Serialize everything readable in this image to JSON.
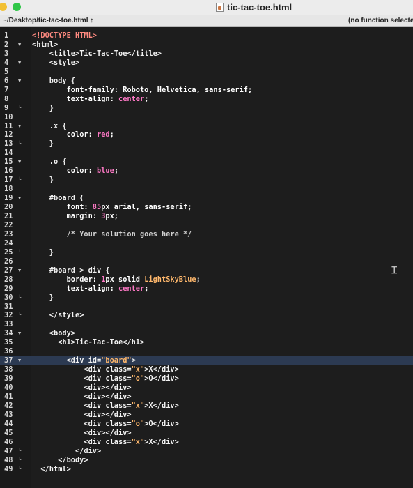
{
  "window": {
    "title": "tic-tac-toe.html"
  },
  "navbar": {
    "path": "~/Desktop/tic-tac-toe.html ↕",
    "function_popup": "(no function selecte"
  },
  "editor": {
    "active_line": 37,
    "lines": [
      {
        "n": "1",
        "fold": "",
        "indent": 0,
        "tokens": [
          [
            "<!DOCTYPE HTML>",
            "doctype"
          ]
        ]
      },
      {
        "n": "2",
        "fold": "down",
        "indent": 0,
        "tokens": [
          [
            "<html>",
            "tag"
          ]
        ]
      },
      {
        "n": "3",
        "fold": "",
        "indent": 2,
        "tokens": [
          [
            "<title>",
            "tag"
          ],
          [
            "Tic-Tac-Toe",
            "txt"
          ],
          [
            "</title>",
            "tag"
          ]
        ]
      },
      {
        "n": "4",
        "fold": "down",
        "indent": 2,
        "tokens": [
          [
            "<style>",
            "tag"
          ]
        ]
      },
      {
        "n": "5",
        "fold": "",
        "indent": 0,
        "tokens": []
      },
      {
        "n": "6",
        "fold": "down",
        "indent": 2,
        "tokens": [
          [
            "body {",
            "sel"
          ]
        ]
      },
      {
        "n": "7",
        "fold": "",
        "indent": 4,
        "tokens": [
          [
            "font-family: ",
            "prop"
          ],
          [
            "Roboto, Helvetica, sans-serif;",
            "prop"
          ]
        ]
      },
      {
        "n": "8",
        "fold": "",
        "indent": 4,
        "tokens": [
          [
            "text-align: ",
            "prop"
          ],
          [
            "center",
            "val"
          ],
          [
            ";",
            "prop"
          ]
        ]
      },
      {
        "n": "9",
        "fold": "end",
        "indent": 2,
        "tokens": [
          [
            "}",
            "sel"
          ]
        ]
      },
      {
        "n": "10",
        "fold": "",
        "indent": 0,
        "tokens": []
      },
      {
        "n": "11",
        "fold": "down",
        "indent": 2,
        "tokens": [
          [
            ".x {",
            "sel"
          ]
        ]
      },
      {
        "n": "12",
        "fold": "",
        "indent": 4,
        "tokens": [
          [
            "color: ",
            "prop"
          ],
          [
            "red",
            "val"
          ],
          [
            ";",
            "prop"
          ]
        ]
      },
      {
        "n": "13",
        "fold": "end",
        "indent": 2,
        "tokens": [
          [
            "}",
            "sel"
          ]
        ]
      },
      {
        "n": "14",
        "fold": "",
        "indent": 0,
        "tokens": []
      },
      {
        "n": "15",
        "fold": "down",
        "indent": 2,
        "tokens": [
          [
            ".o {",
            "sel"
          ]
        ]
      },
      {
        "n": "16",
        "fold": "",
        "indent": 4,
        "tokens": [
          [
            "color: ",
            "prop"
          ],
          [
            "blue",
            "val"
          ],
          [
            ";",
            "prop"
          ]
        ]
      },
      {
        "n": "17",
        "fold": "end",
        "indent": 2,
        "tokens": [
          [
            "}",
            "sel"
          ]
        ]
      },
      {
        "n": "18",
        "fold": "",
        "indent": 0,
        "tokens": []
      },
      {
        "n": "19",
        "fold": "down",
        "indent": 2,
        "tokens": [
          [
            "#board {",
            "sel"
          ]
        ]
      },
      {
        "n": "20",
        "fold": "",
        "indent": 4,
        "tokens": [
          [
            "font: ",
            "prop"
          ],
          [
            "85",
            "num"
          ],
          [
            "px arial, sans-serif;",
            "prop"
          ]
        ]
      },
      {
        "n": "21",
        "fold": "",
        "indent": 4,
        "tokens": [
          [
            "margin: ",
            "prop"
          ],
          [
            "3",
            "num"
          ],
          [
            "px;",
            "prop"
          ]
        ]
      },
      {
        "n": "22",
        "fold": "",
        "indent": 0,
        "tokens": []
      },
      {
        "n": "23",
        "fold": "",
        "indent": 4,
        "tokens": [
          [
            "/* Your solution goes here */",
            "cmt"
          ]
        ]
      },
      {
        "n": "24",
        "fold": "",
        "indent": 0,
        "tokens": []
      },
      {
        "n": "25",
        "fold": "end",
        "indent": 2,
        "tokens": [
          [
            "}",
            "sel"
          ]
        ]
      },
      {
        "n": "26",
        "fold": "",
        "indent": 0,
        "tokens": []
      },
      {
        "n": "27",
        "fold": "down",
        "indent": 2,
        "tokens": [
          [
            "#board > div {",
            "sel"
          ]
        ]
      },
      {
        "n": "28",
        "fold": "",
        "indent": 4,
        "tokens": [
          [
            "border: ",
            "prop"
          ],
          [
            "1",
            "num"
          ],
          [
            "px solid ",
            "prop"
          ],
          [
            "LightSkyBlue",
            "str"
          ],
          [
            ";",
            "prop"
          ]
        ]
      },
      {
        "n": "29",
        "fold": "",
        "indent": 4,
        "tokens": [
          [
            "text-align: ",
            "prop"
          ],
          [
            "center",
            "val"
          ],
          [
            ";",
            "prop"
          ]
        ]
      },
      {
        "n": "30",
        "fold": "end",
        "indent": 2,
        "tokens": [
          [
            "}",
            "sel"
          ]
        ]
      },
      {
        "n": "31",
        "fold": "",
        "indent": 0,
        "tokens": []
      },
      {
        "n": "32",
        "fold": "end",
        "indent": 2,
        "tokens": [
          [
            "</style>",
            "tag"
          ]
        ]
      },
      {
        "n": "33",
        "fold": "",
        "indent": 0,
        "tokens": []
      },
      {
        "n": "34",
        "fold": "down",
        "indent": 2,
        "tokens": [
          [
            "<body>",
            "tag"
          ]
        ]
      },
      {
        "n": "35",
        "fold": "",
        "indent": 3,
        "tokens": [
          [
            "<h1>",
            "tag"
          ],
          [
            "Tic-Tac-Toe",
            "txt"
          ],
          [
            "</h1>",
            "tag"
          ]
        ]
      },
      {
        "n": "36",
        "fold": "",
        "indent": 0,
        "tokens": []
      },
      {
        "n": "37",
        "fold": "down",
        "indent": 4,
        "tokens": [
          [
            "<div ",
            "tag"
          ],
          [
            "id=",
            "tag"
          ],
          [
            "\"board\"",
            "str"
          ],
          [
            ">",
            "tag"
          ]
        ]
      },
      {
        "n": "38",
        "fold": "",
        "indent": 6,
        "tokens": [
          [
            "<div ",
            "tag"
          ],
          [
            "class=",
            "tag"
          ],
          [
            "\"x\"",
            "str"
          ],
          [
            ">",
            "tag"
          ],
          [
            "X",
            "txt"
          ],
          [
            "</div>",
            "tag"
          ]
        ]
      },
      {
        "n": "39",
        "fold": "",
        "indent": 6,
        "tokens": [
          [
            "<div ",
            "tag"
          ],
          [
            "class=",
            "tag"
          ],
          [
            "\"o\"",
            "str"
          ],
          [
            ">",
            "tag"
          ],
          [
            "O",
            "txt"
          ],
          [
            "</div>",
            "tag"
          ]
        ]
      },
      {
        "n": "40",
        "fold": "",
        "indent": 6,
        "tokens": [
          [
            "<div></div>",
            "tag"
          ]
        ]
      },
      {
        "n": "41",
        "fold": "",
        "indent": 6,
        "tokens": [
          [
            "<div></div>",
            "tag"
          ]
        ]
      },
      {
        "n": "42",
        "fold": "",
        "indent": 6,
        "tokens": [
          [
            "<div ",
            "tag"
          ],
          [
            "class=",
            "tag"
          ],
          [
            "\"x\"",
            "str"
          ],
          [
            ">",
            "tag"
          ],
          [
            "X",
            "txt"
          ],
          [
            "</div>",
            "tag"
          ]
        ]
      },
      {
        "n": "43",
        "fold": "",
        "indent": 6,
        "tokens": [
          [
            "<div></div>",
            "tag"
          ]
        ]
      },
      {
        "n": "44",
        "fold": "",
        "indent": 6,
        "tokens": [
          [
            "<div ",
            "tag"
          ],
          [
            "class=",
            "tag"
          ],
          [
            "\"o\"",
            "str"
          ],
          [
            ">",
            "tag"
          ],
          [
            "O",
            "txt"
          ],
          [
            "</div>",
            "tag"
          ]
        ]
      },
      {
        "n": "45",
        "fold": "",
        "indent": 6,
        "tokens": [
          [
            "<div></div>",
            "tag"
          ]
        ]
      },
      {
        "n": "46",
        "fold": "",
        "indent": 6,
        "tokens": [
          [
            "<div ",
            "tag"
          ],
          [
            "class=",
            "tag"
          ],
          [
            "\"x\"",
            "str"
          ],
          [
            ">",
            "tag"
          ],
          [
            "X",
            "txt"
          ],
          [
            "</div>",
            "tag"
          ]
        ]
      },
      {
        "n": "47",
        "fold": "end",
        "indent": 5,
        "tokens": [
          [
            "</div>",
            "tag"
          ]
        ]
      },
      {
        "n": "48",
        "fold": "end",
        "indent": 3,
        "tokens": [
          [
            "</body>",
            "tag"
          ]
        ]
      },
      {
        "n": "49",
        "fold": "end",
        "indent": 1,
        "tokens": [
          [
            "</html>",
            "tag"
          ]
        ]
      }
    ]
  }
}
